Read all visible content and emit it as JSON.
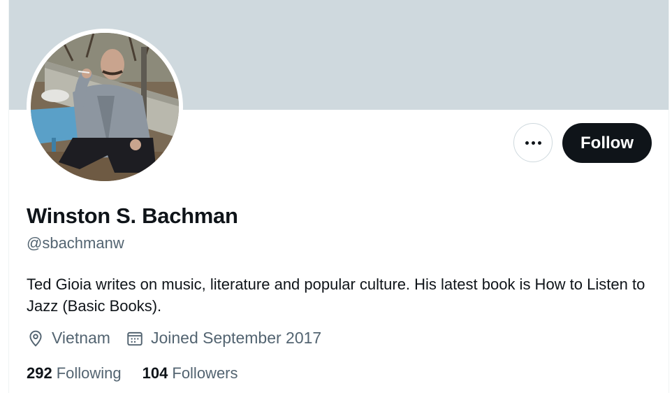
{
  "profile": {
    "display_name": "Winston S. Bachman",
    "handle": "@sbachmanw",
    "bio": "Ted Gioia writes on music, literature and popular culture. His latest book is How to Listen to Jazz (Basic Books).",
    "location": "Vietnam",
    "joined": "Joined September 2017"
  },
  "stats": {
    "following_count": "292",
    "following_label": "Following",
    "followers_count": "104",
    "followers_label": "Followers"
  },
  "actions": {
    "follow_label": "Follow",
    "more_icon": "more-horizontal-icon"
  },
  "icons": {
    "location": "location-pin-icon",
    "calendar": "calendar-icon"
  },
  "colors": {
    "banner": "#cfd9de",
    "follow_button_bg": "#0f1419",
    "secondary_text": "#536471"
  }
}
